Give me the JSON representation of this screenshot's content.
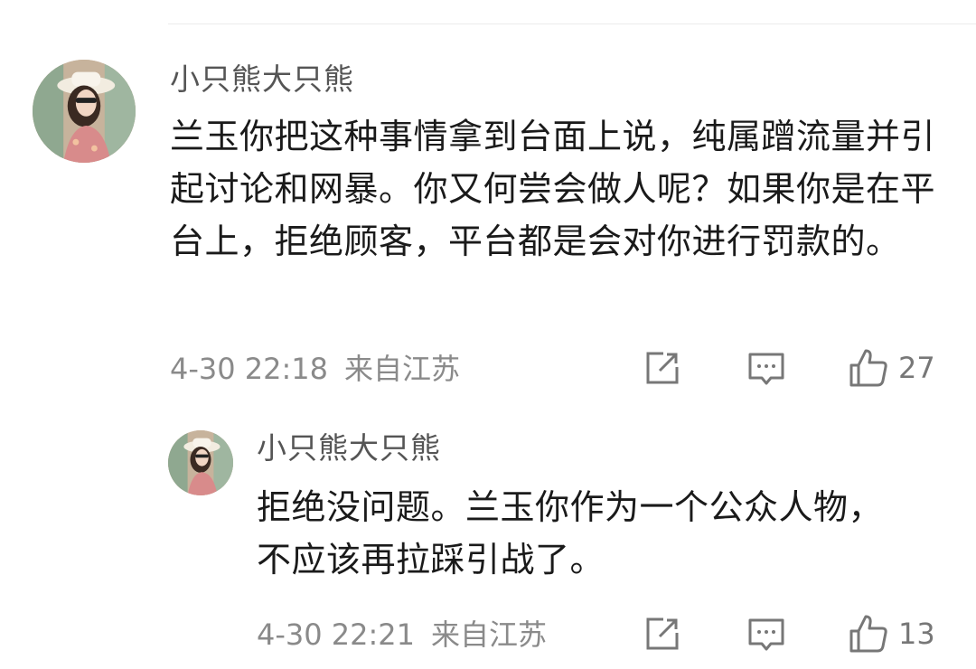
{
  "comments": [
    {
      "username": "小只熊大只熊",
      "content": "兰玉你把这种事情拿到台面上说，纯属蹭流量并引起讨论和网暴。你又何尝会做人呢？如果你是在平台上，拒绝顾客，平台都是会对你进行罚款的。",
      "date": "4-30 22:18",
      "location": "来自江苏",
      "likes": "27"
    },
    {
      "username": "小只熊大只熊",
      "content": "拒绝没问题。兰玉你作为一个公众人物，不应该再拉踩引战了。",
      "date": "4-30 22:21",
      "location": "来自江苏",
      "likes": "13"
    }
  ],
  "icons": {
    "share": "share-icon",
    "comment": "comment-icon",
    "like": "thumbs-up-icon"
  }
}
